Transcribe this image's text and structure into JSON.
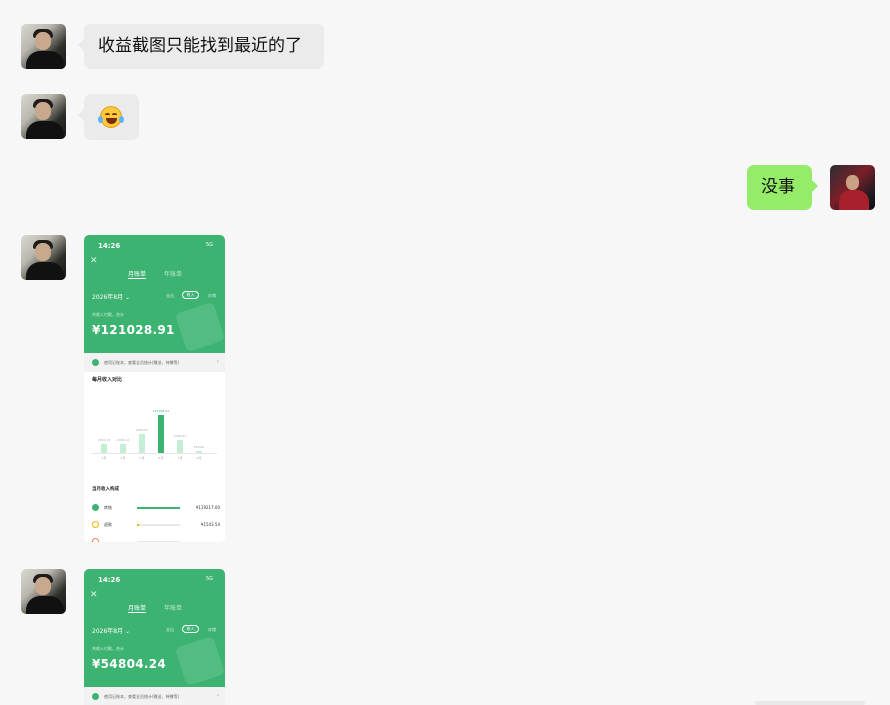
{
  "chat": {
    "msg1_text": "收益截图只能找到最近的了",
    "msg2_emoji": "crying-laughing-face",
    "msg3_text": "没事"
  },
  "colors": {
    "background": "#f7f7f7",
    "bubble_received": "#ebebeb",
    "bubble_sent": "#95ec69",
    "screenshot_green": "#3cb371"
  },
  "screenshot1": {
    "status_time": "14:26",
    "status_net": "5G",
    "tab_active": "月账单",
    "tab_other": "年账单",
    "month": "2026年8月 ⌄",
    "filter_out": "支出",
    "filter_in": "收入",
    "filter_stat": "存储",
    "subtitle": "共收入付款，合计",
    "amount": "¥121028.91",
    "tip": "使用记账本，查看全员统计(赠送，待赠等)",
    "chart_title": "每月收入对比",
    "breakdown_title": "当月收入构成",
    "rows": [
      {
        "name": "转账",
        "amount": "¥119217.00"
      },
      {
        "name": "退款",
        "amount": "¥1543.54"
      },
      {
        "name": "",
        "amount": ""
      }
    ],
    "chart_data": {
      "type": "bar",
      "categories": [
        "3月",
        "4月",
        "5月",
        "6月",
        "7月",
        "8月"
      ],
      "values": [
        24,
        23,
        51,
        100,
        34,
        6
      ],
      "highlight_index": 3,
      "value_labels": [
        "2810.15",
        "2430.12",
        "4950.63",
        "121028.91",
        "3330.01",
        "450.00"
      ]
    }
  },
  "screenshot2": {
    "status_time": "14:26",
    "status_net": "5G",
    "tab_active": "月账单",
    "tab_other": "年账单",
    "month": "2026年8月 ⌄",
    "filter_out": "支出",
    "filter_in": "收入",
    "filter_stat": "存储",
    "subtitle": "共收入付款，合计",
    "amount": "¥54804.24",
    "tip": "使用记账本，查看全员统计(赠送，待赠等)"
  }
}
